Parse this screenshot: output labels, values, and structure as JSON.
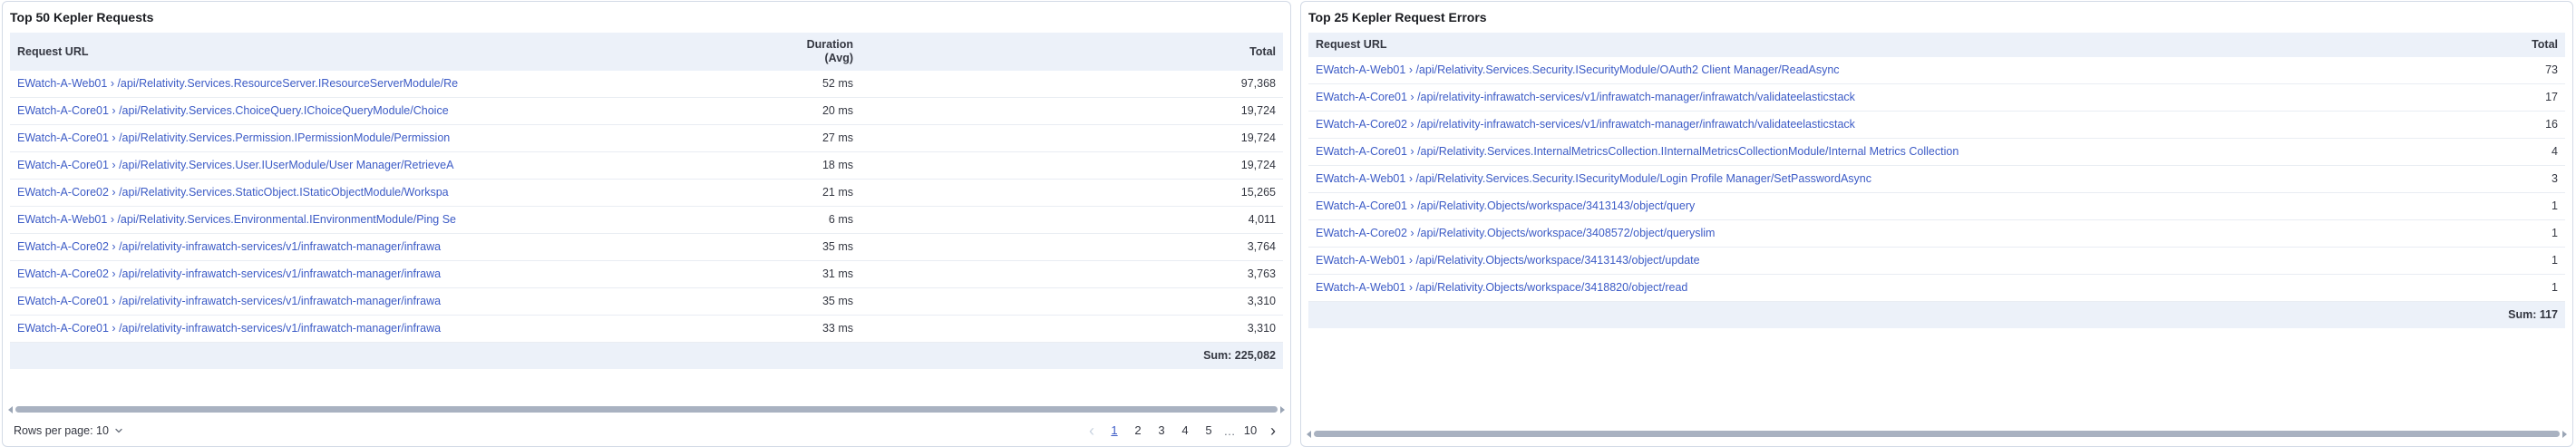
{
  "colors": {
    "link": "#3C5BC6",
    "header_row_bg": "#ECF1F9",
    "sum_row_bg": "#ECF1F9",
    "panel_border": "#D3DAE6",
    "text": "#343741",
    "current_page": "#3C5BC6",
    "scrollbar_thumb": "#A9B2C1"
  },
  "left_panel": {
    "title": "Top 50 Kepler Requests",
    "columns": [
      "Request URL",
      "Duration (Avg)",
      "Total"
    ],
    "rows": [
      {
        "url": "EWatch-A-Web01 › /api/Relativity.Services.ResourceServer.IResourceServerModule/Re",
        "duration": "52 ms",
        "total": "97,368"
      },
      {
        "url": "EWatch-A-Core01 › /api/Relativity.Services.ChoiceQuery.IChoiceQueryModule/Choice",
        "duration": "20 ms",
        "total": "19,724"
      },
      {
        "url": "EWatch-A-Core01 › /api/Relativity.Services.Permission.IPermissionModule/Permission",
        "duration": "27 ms",
        "total": "19,724"
      },
      {
        "url": "EWatch-A-Core01 › /api/Relativity.Services.User.IUserModule/User Manager/RetrieveA",
        "duration": "18 ms",
        "total": "19,724"
      },
      {
        "url": "EWatch-A-Core02 › /api/Relativity.Services.StaticObject.IStaticObjectModule/Workspa",
        "duration": "21 ms",
        "total": "15,265"
      },
      {
        "url": "EWatch-A-Web01 › /api/Relativity.Services.Environmental.IEnvironmentModule/Ping Se",
        "duration": "6 ms",
        "total": "4,011"
      },
      {
        "url": "EWatch-A-Core02 › /api/relativity-infrawatch-services/v1/infrawatch-manager/infrawa",
        "duration": "35 ms",
        "total": "3,764"
      },
      {
        "url": "EWatch-A-Core02 › /api/relativity-infrawatch-services/v1/infrawatch-manager/infrawa",
        "duration": "31 ms",
        "total": "3,763"
      },
      {
        "url": "EWatch-A-Core01 › /api/relativity-infrawatch-services/v1/infrawatch-manager/infrawa",
        "duration": "35 ms",
        "total": "3,310"
      },
      {
        "url": "EWatch-A-Core01 › /api/relativity-infrawatch-services/v1/infrawatch-manager/infrawa",
        "duration": "33 ms",
        "total": "3,310"
      }
    ],
    "sum_label": "Sum: 225,082",
    "footer": {
      "rows_per_page_label": "Rows per page: 10",
      "pagination": {
        "prev": "‹",
        "pages": [
          "1",
          "2",
          "3",
          "4",
          "5"
        ],
        "current": "1",
        "ellipsis": "…",
        "last": "10",
        "next": "›"
      }
    }
  },
  "right_panel": {
    "title": "Top 25 Kepler Request Errors",
    "columns": [
      "Request URL",
      "Total"
    ],
    "rows": [
      {
        "url": "EWatch-A-Web01 › /api/Relativity.Services.Security.ISecurityModule/OAuth2 Client Manager/ReadAsync",
        "total": "73"
      },
      {
        "url": "EWatch-A-Core01 › /api/relativity-infrawatch-services/v1/infrawatch-manager/infrawatch/validateelasticstack",
        "total": "17"
      },
      {
        "url": "EWatch-A-Core02 › /api/relativity-infrawatch-services/v1/infrawatch-manager/infrawatch/validateelasticstack",
        "total": "16"
      },
      {
        "url": "EWatch-A-Core01 › /api/Relativity.Services.InternalMetricsCollection.IInternalMetricsCollectionModule/Internal Metrics Collection",
        "total": "4"
      },
      {
        "url": "EWatch-A-Web01 › /api/Relativity.Services.Security.ISecurityModule/Login Profile Manager/SetPasswordAsync",
        "total": "3"
      },
      {
        "url": "EWatch-A-Core01 › /api/Relativity.Objects/workspace/3413143/object/query",
        "total": "1"
      },
      {
        "url": "EWatch-A-Core02 › /api/Relativity.Objects/workspace/3408572/object/queryslim",
        "total": "1"
      },
      {
        "url": "EWatch-A-Web01 › /api/Relativity.Objects/workspace/3413143/object/update",
        "total": "1"
      },
      {
        "url": "EWatch-A-Web01 › /api/Relativity.Objects/workspace/3418820/object/read",
        "total": "1"
      }
    ],
    "sum_label": "Sum: 117"
  }
}
